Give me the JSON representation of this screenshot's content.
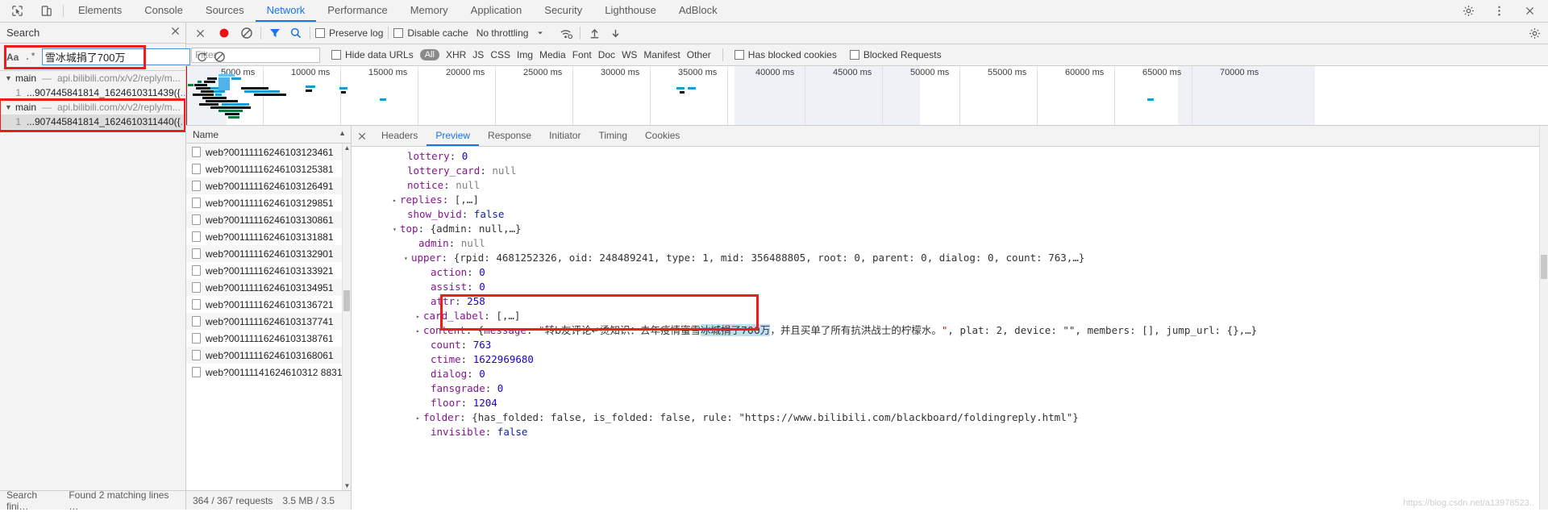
{
  "devtools": {
    "main_tabs": [
      {
        "label": "Elements",
        "active": false
      },
      {
        "label": "Console",
        "active": false
      },
      {
        "label": "Sources",
        "active": false
      },
      {
        "label": "Network",
        "active": true
      },
      {
        "label": "Performance",
        "active": false
      },
      {
        "label": "Memory",
        "active": false
      },
      {
        "label": "Application",
        "active": false
      },
      {
        "label": "Security",
        "active": false
      },
      {
        "label": "Lighthouse",
        "active": false
      },
      {
        "label": "AdBlock",
        "active": false
      }
    ],
    "icons": {
      "inspect": "inspect-element-icon",
      "device": "device-toolbar-icon",
      "settings": "gear-icon",
      "more": "more-vertical-icon",
      "close": "close-icon"
    }
  },
  "search_pane": {
    "title": "Search",
    "close_icon": "close-icon",
    "match_case_label": "Aa",
    "regex_label": ".*",
    "query": "雪冰城捐了700万",
    "refresh_icon": "refresh-icon",
    "clear_icon": "clear-icon",
    "results": [
      {
        "file": "main",
        "dash": "—",
        "url": "api.bilibili.com/x/v2/reply/m...",
        "line_no": "1",
        "line_text": "...907445841814_1624610311439({",
        "line_suffix": "...",
        "selected": false,
        "annotated": false
      },
      {
        "file": "main",
        "dash": "—",
        "url": "api.bilibili.com/x/v2/reply/m...",
        "line_no": "1",
        "line_text": "...907445841814_1624610311440({",
        "line_suffix": "...",
        "selected": true,
        "annotated": true
      }
    ],
    "status": "Search fini…",
    "status_detail": "Found 2 matching lines …"
  },
  "network_toolbar": {
    "record_icon": "record-stop-icon",
    "clear_icon": "clear-icon",
    "filter_icon": "filter-funnel-icon",
    "search_icon": "search-icon",
    "preserve_log": {
      "label": "Preserve log",
      "checked": false
    },
    "disable_cache": {
      "label": "Disable cache",
      "checked": false
    },
    "throttling": "No throttling",
    "throttle_chevron": "chevron-down-icon",
    "wifi_icon": "network-conditions-icon",
    "import_icon": "import-har-icon",
    "export_icon": "export-har-icon",
    "settings_icon": "gear-icon"
  },
  "filter_bar": {
    "filter_placeholder": "Filter",
    "hide_data_urls": {
      "label": "Hide data URLs",
      "checked": false
    },
    "types": [
      "All",
      "XHR",
      "JS",
      "CSS",
      "Img",
      "Media",
      "Font",
      "Doc",
      "WS",
      "Manifest",
      "Other"
    ],
    "active_type": "All",
    "has_blocked_cookies": {
      "label": "Has blocked cookies",
      "checked": false
    },
    "blocked_requests": {
      "label": "Blocked Requests",
      "checked": false
    }
  },
  "overview": {
    "tick_labels": [
      "5000 ms",
      "10000 ms",
      "15000 ms",
      "20000 ms",
      "25000 ms",
      "30000 ms",
      "35000 ms",
      "40000 ms",
      "45000 ms",
      "50000 ms",
      "55000 ms",
      "60000 ms",
      "65000 ms",
      "70000 ms"
    ]
  },
  "request_list": {
    "column_header": "Name",
    "sort_arrow": "sort-asc-icon",
    "rows": [
      "web?00111116246103123461",
      "web?00111116246103125381",
      "web?00111116246103126491",
      "web?00111116246103129851",
      "web?00111116246103130861",
      "web?00111116246103131881",
      "web?00111116246103132901",
      "web?00111116246103133921",
      "web?00111116246103134951",
      "web?00111116246103136721",
      "web?00111116246103137741",
      "web?00111116246103138761",
      "web?00111116246103168061",
      "web?00111141624610312 8831"
    ],
    "status_requests": "364 / 367 requests",
    "status_size": "3.5 MB / 3.5"
  },
  "detail": {
    "close_icon": "close-icon",
    "tabs": [
      {
        "label": "Headers",
        "active": false
      },
      {
        "label": "Preview",
        "active": true
      },
      {
        "label": "Response",
        "active": false
      },
      {
        "label": "Initiator",
        "active": false
      },
      {
        "label": "Timing",
        "active": false
      },
      {
        "label": "Cookies",
        "active": false
      }
    ],
    "json_lines": [
      {
        "indent": 1,
        "tri": "none",
        "key": "lottery",
        "sep": ": ",
        "value": "0",
        "vtype": "num"
      },
      {
        "indent": 1,
        "tri": "none",
        "key": "lottery_card",
        "sep": ": ",
        "value": "null",
        "vtype": "nul"
      },
      {
        "indent": 1,
        "tri": "none",
        "key": "notice",
        "sep": ": ",
        "value": "null",
        "vtype": "nul"
      },
      {
        "indent": 1,
        "tri": "closed",
        "key": "replies",
        "sep": ": ",
        "value": "[,…]",
        "vtype": "punc"
      },
      {
        "indent": 1,
        "tri": "none",
        "key": "show_bvid",
        "sep": ": ",
        "value": "false",
        "vtype": "bool"
      },
      {
        "indent": 1,
        "tri": "open",
        "key": "top",
        "sep": ": ",
        "value": "{admin: null,…}",
        "vtype": "punc"
      },
      {
        "indent": 2,
        "tri": "none",
        "key": "admin",
        "sep": ": ",
        "value": "null",
        "vtype": "nul"
      },
      {
        "indent": 2,
        "tri": "open",
        "key": "upper",
        "sep": ": ",
        "value": "{rpid: 4681252326, oid: 248489241, type: 1, mid: 356488805, root: 0, parent: 0, dialog: 0, count: 763,…}",
        "vtype": "punc"
      },
      {
        "indent": 3,
        "tri": "none",
        "key": "action",
        "sep": ": ",
        "value": "0",
        "vtype": "num"
      },
      {
        "indent": 3,
        "tri": "none",
        "key": "assist",
        "sep": ": ",
        "value": "0",
        "vtype": "num"
      },
      {
        "indent": 3,
        "tri": "none",
        "key": "attr",
        "sep": ": ",
        "value": "258",
        "vtype": "num"
      },
      {
        "indent": 3,
        "tri": "closed",
        "key": "card_label",
        "sep": ": ",
        "value": "[,…]",
        "vtype": "punc"
      },
      {
        "indent": 3,
        "tri": "closed",
        "key": "content",
        "sep": ": ",
        "value": "CONTENT_ROW",
        "vtype": "special"
      },
      {
        "indent": 3,
        "tri": "none",
        "key": "count",
        "sep": ": ",
        "value": "763",
        "vtype": "num"
      },
      {
        "indent": 3,
        "tri": "none",
        "key": "ctime",
        "sep": ": ",
        "value": "1622969680",
        "vtype": "num"
      },
      {
        "indent": 3,
        "tri": "none",
        "key": "dialog",
        "sep": ": ",
        "value": "0",
        "vtype": "num"
      },
      {
        "indent": 3,
        "tri": "none",
        "key": "fansgrade",
        "sep": ": ",
        "value": "0",
        "vtype": "num"
      },
      {
        "indent": 3,
        "tri": "none",
        "key": "floor",
        "sep": ": ",
        "value": "1204",
        "vtype": "num"
      },
      {
        "indent": 3,
        "tri": "closed",
        "key": "folder",
        "sep": ": ",
        "value": "{has_folded: false, is_folded: false, rule: \"https://www.bilibili.com/blackboard/foldingreply.html\"}",
        "vtype": "punc"
      },
      {
        "indent": 3,
        "tri": "none",
        "key": "invisible",
        "sep": ": ",
        "value": "false",
        "vtype": "bool"
      }
    ],
    "content_row": {
      "open_brace": "{",
      "message_key": "message",
      "quote": "\"",
      "msg_part1": "转b友评论↵烫知识：去年疫情蜜雪",
      "msg_highlight": "冰城捐了700万",
      "msg_part2": "，并且买单了所有抗洪战士的柠檬水。",
      "tail": ", plat: 2, device: \"\", members: [], jump_url: {},…}"
    }
  },
  "watermark": "https://blog.csdn.net/a13978523..",
  "colors": {
    "accent": "#1a73e8",
    "annotation": "#ee1c1c",
    "highlight": "#bfdcf4",
    "key": "#881391",
    "number": "#1c00cf",
    "string": "#c41a16"
  }
}
